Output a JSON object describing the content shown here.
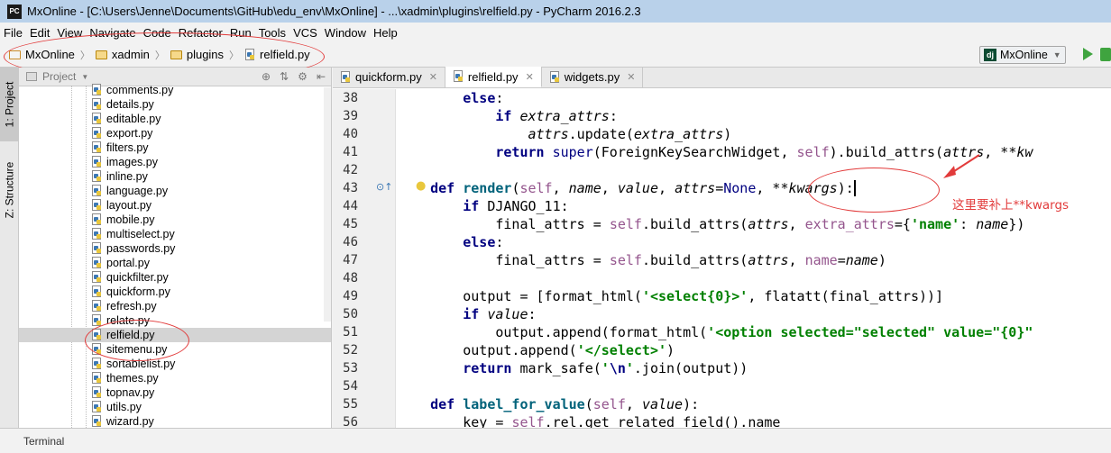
{
  "window": {
    "title": "MxOnline - [C:\\Users\\Jenne\\Documents\\GitHub\\edu_env\\MxOnline] - ...\\xadmin\\plugins\\relfield.py - PyCharm 2016.2.3",
    "app_icon": "PC"
  },
  "menu": [
    "File",
    "Edit",
    "View",
    "Navigate",
    "Code",
    "Refactor",
    "Run",
    "Tools",
    "VCS",
    "Window",
    "Help"
  ],
  "breadcrumb": [
    "MxOnline",
    "xadmin",
    "plugins",
    "relfield.py"
  ],
  "run_config": {
    "label": "MxOnline",
    "icon": "dj"
  },
  "left_tabs": [
    "1: Project",
    "Z: Structure"
  ],
  "project_panel": {
    "title": "Project",
    "files": [
      "comments.py",
      "details.py",
      "editable.py",
      "export.py",
      "filters.py",
      "images.py",
      "inline.py",
      "language.py",
      "layout.py",
      "mobile.py",
      "multiselect.py",
      "passwords.py",
      "portal.py",
      "quickfilter.py",
      "quickform.py",
      "refresh.py",
      "relate.py",
      "relfield.py",
      "sitemenu.py",
      "sortablelist.py",
      "themes.py",
      "topnav.py",
      "utils.py",
      "wizard.py"
    ],
    "selected": "relfield.py"
  },
  "editor": {
    "tabs": [
      {
        "label": "quickform.py",
        "active": false
      },
      {
        "label": "relfield.py",
        "active": true
      },
      {
        "label": "widgets.py",
        "active": false
      }
    ],
    "line_numbers": [
      "38",
      "39",
      "40",
      "41",
      "42",
      "43",
      "44",
      "45",
      "46",
      "47",
      "48",
      "49",
      "50",
      "51",
      "52",
      "53",
      "54",
      "55",
      "56"
    ]
  },
  "annotation": "这里要补上**kwargs",
  "status": {
    "terminal_label": "Terminal"
  },
  "colors": {
    "accent_red": "#e23b3b",
    "keyword": "#000080",
    "string": "#008000",
    "self": "#94558d"
  }
}
